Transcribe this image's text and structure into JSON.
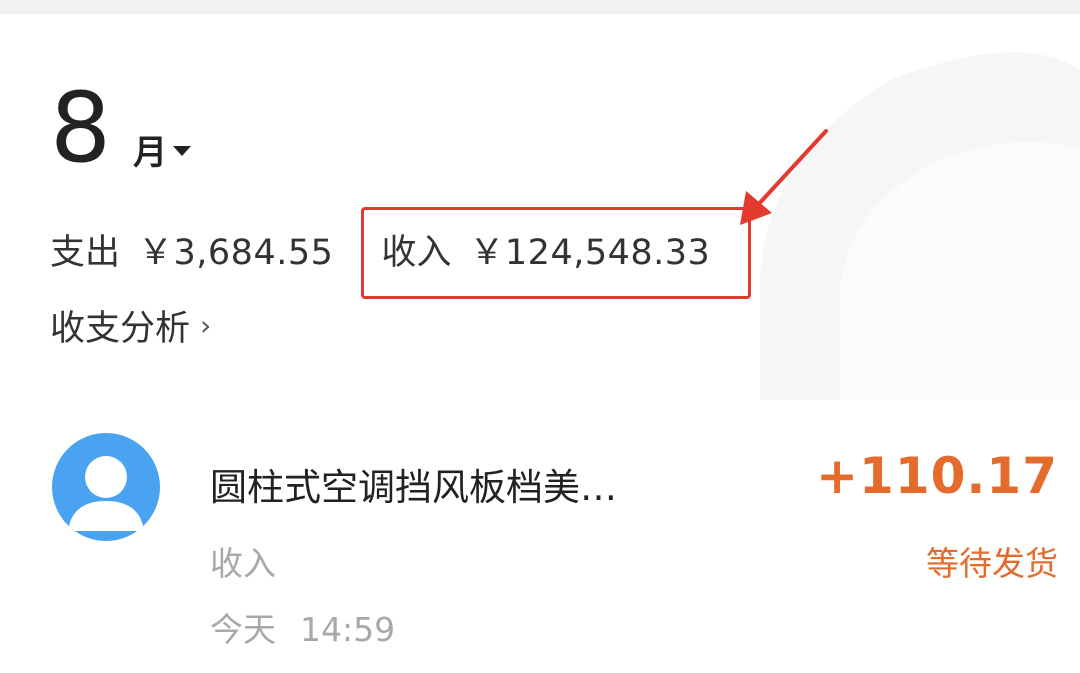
{
  "header": {
    "month_number": "8",
    "month_unit": "月",
    "month_picker_icon": "caret-down-icon"
  },
  "summary": {
    "expense_label": "支出",
    "expense_amount": "￥3,684.55",
    "income_label": "收入",
    "income_amount": "￥124,548.33"
  },
  "analysis_link": {
    "label": "收支分析",
    "icon": "chevron-right-icon"
  },
  "annotation": {
    "color": "#e23a2e",
    "shapes": [
      "highlight-box",
      "arrow"
    ]
  },
  "transactions": [
    {
      "avatar_icon": "user-avatar-icon",
      "avatar_color": "#4aa3f0",
      "title": "圆柱式空调挡风板档美…",
      "type": "收入",
      "date": "今天",
      "time": "14:59",
      "amount": "+110.17",
      "status": "等待发货",
      "accent_color": "#e46b2c"
    }
  ]
}
